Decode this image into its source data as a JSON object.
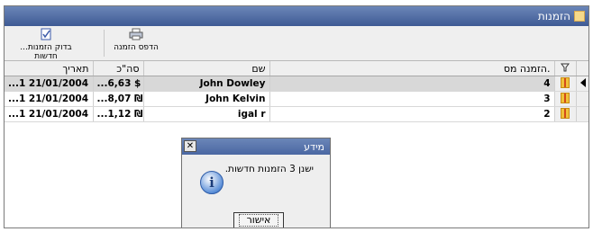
{
  "window": {
    "title": "הזמנות"
  },
  "toolbar": {
    "print_label": "הדפס הזמנה",
    "check_label": "...בדוק הזמנות חדשות"
  },
  "grid": {
    "columns": [
      "",
      "הזמנה מס.",
      "שם",
      "סה\"כ",
      "תאריך"
    ],
    "rows": [
      {
        "order_no": "4",
        "name": "John Dowley",
        "total": "...6,63 $",
        "date": "...1 21/01/2004",
        "selected": true
      },
      {
        "order_no": "3",
        "name": "John Kelvin",
        "total": "...8,07 ₪",
        "date": "...1 21/01/2004",
        "selected": false
      },
      {
        "order_no": "2",
        "name": "igal r",
        "total": "...1,12 ₪",
        "date": "...1 21/01/2004",
        "selected": false
      }
    ]
  },
  "dialog": {
    "title": "מידע",
    "message": "ישנן 3 הזמנות חדשות.",
    "ok_label": "אישור"
  },
  "icons": [
    "window-icon",
    "check-orders-icon",
    "printer-icon",
    "filter-icon",
    "gift-icon",
    "row-pointer-icon",
    "info-icon",
    "close-icon"
  ]
}
